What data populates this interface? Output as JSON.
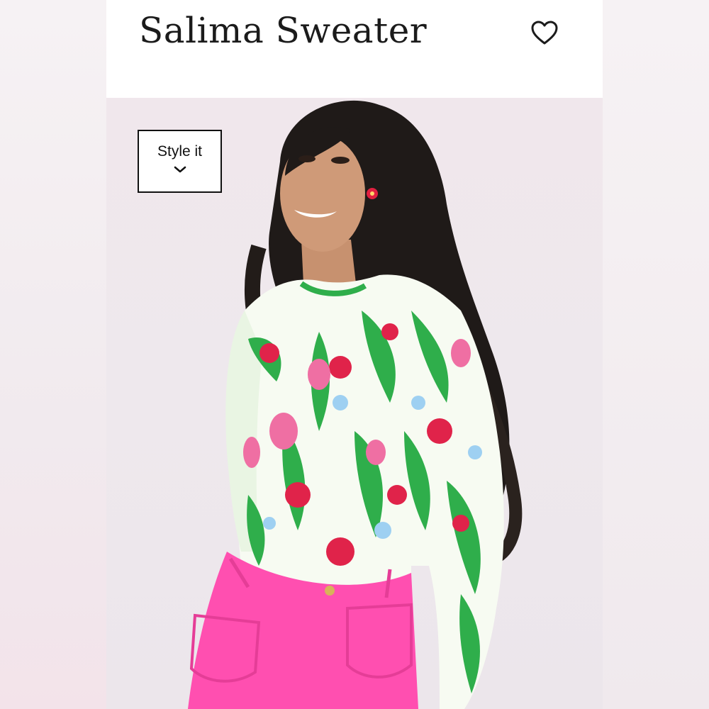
{
  "product": {
    "title": "Salima Sweater",
    "favorite_icon": "heart-outline-icon"
  },
  "style_it": {
    "label": "Style it",
    "icon": "chevron-down-icon"
  },
  "colors": {
    "header_bg": "#ffffff",
    "backdrop": "#efe8ec",
    "pants_pink": "#ff4fb0",
    "print_green": "#2fae4b",
    "print_red": "#e0234a"
  }
}
